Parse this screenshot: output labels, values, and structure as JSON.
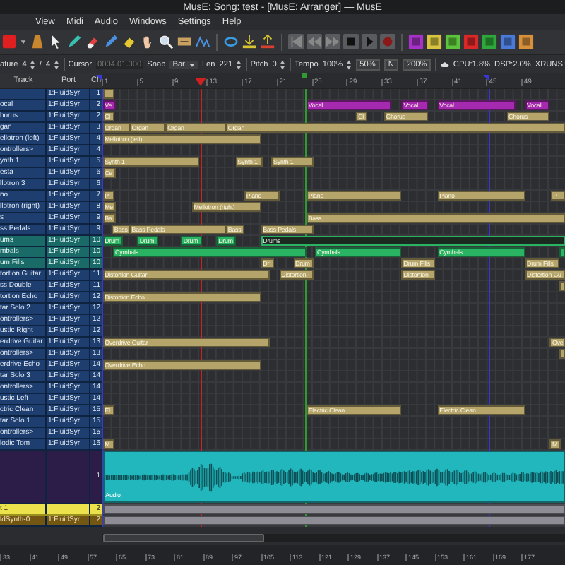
{
  "window": {
    "title": "MusE: Song: test - [MusE: Arranger] — MusE"
  },
  "menu": [
    "View",
    "Midi",
    "Audio",
    "Windows",
    "Settings",
    "Help"
  ],
  "options": [
    {
      "kind": "label",
      "text": "ature"
    },
    {
      "kind": "spin",
      "text": "4"
    },
    {
      "kind": "label",
      "text": "/"
    },
    {
      "kind": "spin",
      "text": "4"
    },
    {
      "kind": "sep"
    },
    {
      "kind": "label",
      "text": "Cursor"
    },
    {
      "kind": "field",
      "text": "0004.01.000"
    },
    {
      "kind": "label",
      "text": "Snap"
    },
    {
      "kind": "dropdown",
      "text": "Bar"
    },
    {
      "kind": "label",
      "text": "Len"
    },
    {
      "kind": "spin",
      "text": "221"
    },
    {
      "kind": "sep"
    },
    {
      "kind": "label",
      "text": "Pitch"
    },
    {
      "kind": "spin",
      "text": "0"
    },
    {
      "kind": "sep"
    },
    {
      "kind": "label",
      "text": "Tempo"
    },
    {
      "kind": "spin",
      "text": "100%"
    },
    {
      "kind": "button",
      "text": "50%"
    },
    {
      "kind": "button",
      "text": "N"
    },
    {
      "kind": "button",
      "text": "200%"
    },
    {
      "kind": "sep"
    },
    {
      "kind": "icon"
    },
    {
      "kind": "label",
      "text": "CPU:1.8%"
    },
    {
      "kind": "label",
      "text": "DSP:2.0%"
    },
    {
      "kind": "label",
      "text": "XRUNS:"
    }
  ],
  "columns": [
    "Track",
    "Port",
    "Ch"
  ],
  "ruler": [
    "1",
    "5",
    "9",
    "13",
    "17",
    "21",
    "25",
    "29",
    "33",
    "37",
    "41",
    "45",
    "49"
  ],
  "markers": [
    {
      "kind": "left"
    },
    {
      "kind": "cursor"
    },
    {
      "kind": "song"
    },
    {
      "kind": "right"
    }
  ],
  "tracks": [
    {
      "port": "1:FluidSyr",
      "ch": "1",
      "kind": "midi",
      "color": "#b5a56b",
      "parts": [
        {
          "selected": false
        }
      ]
    },
    {
      "name": "ocal",
      "port": "1:FluidSyr",
      "ch": "2",
      "kind": "midi",
      "color": "#a62ab0",
      "parts": [
        {
          "label": "Ve",
          "selected": false
        },
        {
          "label": "Vocal",
          "selected": false
        },
        {
          "label": "Vocal",
          "selected": false
        },
        {
          "label": "Vocal",
          "selected": false
        },
        {
          "label": "Vocal",
          "selected": false
        }
      ]
    },
    {
      "name": "horus",
      "port": "1:FluidSyr",
      "ch": "2",
      "kind": "midi",
      "color": "#b5a56b",
      "parts": [
        {
          "label": "Cl",
          "selected": false
        },
        {
          "label": "Cl",
          "selected": false
        },
        {
          "label": "Chorus",
          "selected": false
        },
        {
          "label": "Chorus",
          "selected": false
        }
      ]
    },
    {
      "name": "gan",
      "port": "1:FluidSyr",
      "ch": "3",
      "kind": "midi",
      "color": "#b5a56b",
      "parts": [
        {
          "label": "Organ",
          "selected": false
        },
        {
          "label": "Organ",
          "selected": false
        },
        {
          "label": "Organ",
          "selected": false
        },
        {
          "label": "Organ",
          "selected": false
        }
      ]
    },
    {
      "name": "ellotron (left)",
      "port": "1:FluidSyr",
      "ch": "4",
      "kind": "midi",
      "color": "#b5a56b",
      "parts": [
        {
          "label": "Mellotron (left)",
          "selected": false
        }
      ]
    },
    {
      "name": "ontrollers>",
      "port": "1:FluidSyr",
      "ch": "4",
      "kind": "midi"
    },
    {
      "name": "ynth 1",
      "port": "1:FluidSyr",
      "ch": "5",
      "kind": "midi",
      "color": "#b5a56b",
      "parts": [
        {
          "label": "Synth 1",
          "selected": false
        },
        {
          "label": "Synth 1",
          "selected": false
        },
        {
          "label": "Synth 1",
          "selected": false
        }
      ]
    },
    {
      "name": "esta",
      "port": "1:FluidSyr",
      "ch": "6",
      "kind": "midi",
      "color": "#b5a56b",
      "parts": [
        {
          "label": "Ce",
          "selected": false
        }
      ]
    },
    {
      "name": "llotron 3",
      "port": "1:FluidSyr",
      "ch": "6",
      "kind": "midi"
    },
    {
      "name": "no",
      "port": "1:FluidSyr",
      "ch": "7",
      "kind": "midi",
      "color": "#b5a56b",
      "parts": [
        {
          "label": "P",
          "selected": false
        },
        {
          "label": "Piano",
          "selected": false
        },
        {
          "label": "Piano",
          "selected": false
        },
        {
          "label": "Piano",
          "selected": false
        },
        {
          "label": "P",
          "selected": false
        }
      ]
    },
    {
      "name": "llotron (right)",
      "port": "1:FluidSyr",
      "ch": "8",
      "kind": "midi",
      "color": "#b5a56b",
      "parts": [
        {
          "label": "Me",
          "selected": false
        },
        {
          "label": "Mellotron (right)",
          "selected": false
        }
      ]
    },
    {
      "name": "s",
      "port": "1:FluidSyr",
      "ch": "9",
      "kind": "midi",
      "color": "#b5a56b",
      "parts": [
        {
          "label": "Ba",
          "selected": false
        },
        {
          "label": "Bass",
          "selected": false
        }
      ]
    },
    {
      "name": "ss Pedals",
      "port": "1:FluidSyr",
      "ch": "9",
      "kind": "midi",
      "color": "#b5a56b",
      "parts": [
        {
          "label": "Bass",
          "selected": false
        },
        {
          "label": "Bass Pedals",
          "selected": false
        },
        {
          "label": "Bass",
          "selected": false
        },
        {
          "label": "Bass Pedals",
          "selected": false
        }
      ]
    },
    {
      "name": "ums",
      "port": "1:FluidSyr",
      "ch": "10",
      "kind": "drum",
      "color": "#2bb364",
      "parts": [
        {
          "label": "Drum",
          "selected": false
        },
        {
          "label": "Drum",
          "selected": false
        },
        {
          "label": "Drum",
          "selected": false
        },
        {
          "label": "Drum",
          "selected": false
        },
        {
          "label": "Drums",
          "selected": true
        }
      ]
    },
    {
      "name": "mbals",
      "port": "1:FluidSyr",
      "ch": "10",
      "kind": "drum",
      "color": "#2bb364",
      "parts": [
        {
          "label": "Cymbals",
          "selected": false
        },
        {
          "label": "Cymbals",
          "selected": false
        },
        {
          "label": "Cymbals",
          "selected": false
        },
        {
          "selected": false
        }
      ]
    },
    {
      "name": "um Fills",
      "port": "1:FluidSyr",
      "ch": "10",
      "kind": "drum",
      "color": "#b5a56b",
      "parts": [
        {
          "label": "Dr",
          "selected": false
        },
        {
          "label": "Drum",
          "selected": false
        },
        {
          "label": "Drum Fills",
          "selected": false
        },
        {
          "label": "Drum Fills",
          "selected": false
        }
      ]
    },
    {
      "name": "tortion Guitar",
      "port": "1:FluidSyr",
      "ch": "11",
      "kind": "midi",
      "color": "#b5a56b",
      "parts": [
        {
          "label": "Distortion Guitar",
          "selected": false
        },
        {
          "label": "Distortion",
          "selected": false
        },
        {
          "label": "Distortion",
          "selected": false
        },
        {
          "label": "Distortion Gu",
          "selected": false
        }
      ]
    },
    {
      "name": "ss Double",
      "port": "1:FluidSyr",
      "ch": "11",
      "kind": "midi",
      "color": "#b5a56b",
      "parts": [
        {
          "selected": false
        }
      ]
    },
    {
      "name": "tortion Echo",
      "port": "1:FluidSyr",
      "ch": "12",
      "kind": "midi",
      "color": "#b5a56b",
      "parts": [
        {
          "label": "Distortion Echo",
          "selected": false
        }
      ]
    },
    {
      "name": "tar Solo 2",
      "port": "1:FluidSyr",
      "ch": "12",
      "kind": "midi"
    },
    {
      "name": "ontrollers>",
      "port": "1:FluidSyr",
      "ch": "12",
      "kind": "midi"
    },
    {
      "name": "ustic Right",
      "port": "1:FluidSyr",
      "ch": "12",
      "kind": "midi"
    },
    {
      "name": "erdrive Guitar",
      "port": "1:FluidSyr",
      "ch": "13",
      "kind": "midi",
      "color": "#b5a56b",
      "parts": [
        {
          "label": "Overdrive Guitar",
          "selected": false
        },
        {
          "label": "Ove",
          "selected": false
        }
      ]
    },
    {
      "name": "ontrollers>",
      "port": "1:FluidSyr",
      "ch": "13",
      "kind": "midi",
      "color": "#b5a56b",
      "parts": [
        {
          "selected": false
        }
      ]
    },
    {
      "name": "erdrive Echo",
      "port": "1:FluidSyr",
      "ch": "14",
      "kind": "midi",
      "color": "#b5a56b",
      "parts": [
        {
          "label": "Overdrive Echo",
          "selected": false
        }
      ]
    },
    {
      "name": "tar Solo 3",
      "port": "1:FluidSyr",
      "ch": "14",
      "kind": "midi"
    },
    {
      "name": "ontrollers>",
      "port": "1:FluidSyr",
      "ch": "14",
      "kind": "midi"
    },
    {
      "name": "ustic Left",
      "port": "1:FluidSyr",
      "ch": "14",
      "kind": "midi"
    },
    {
      "name": "ctric Clean",
      "port": "1:FluidSyr",
      "ch": "15",
      "kind": "midi",
      "color": "#b5a56b",
      "parts": [
        {
          "label": "El",
          "selected": false
        },
        {
          "label": "Electric Clean",
          "selected": false
        },
        {
          "label": "Electric Clean",
          "selected": false
        }
      ]
    },
    {
      "name": "tar Solo 1",
      "port": "1:FluidSyr",
      "ch": "15",
      "kind": "midi"
    },
    {
      "name": "ontrollers>",
      "port": "1:FluidSyr",
      "ch": "15",
      "kind": "midi"
    },
    {
      "name": "lodic Tom",
      "port": "1:FluidSyr",
      "ch": "16",
      "kind": "midi",
      "color": "#b5a56b",
      "parts": [
        {
          "label": "M",
          "selected": false
        },
        {
          "label": "M",
          "selected": false
        }
      ]
    },
    {
      "ch": "1",
      "kind": "audio",
      "color": "#21b7bd",
      "parts": [
        {
          "label": "Audio",
          "selected": false
        }
      ]
    },
    {
      "name": "t 1",
      "ch": "2",
      "kind": "synth",
      "color": "#8e8c95",
      "parts": [
        {
          "selected": false
        }
      ]
    },
    {
      "name": "ldSynth-0",
      "port": "1:FluidSyr",
      "ch": "2",
      "kind": "output",
      "color": "#8e8c95",
      "parts": [
        {
          "selected": false
        }
      ]
    }
  ],
  "bottom_ruler": [
    "33",
    "41",
    "49",
    "57",
    "65",
    "73",
    "81",
    "89",
    "97",
    "105",
    "113",
    "121",
    "129",
    "137",
    "145",
    "153",
    "161",
    "169",
    "177"
  ]
}
